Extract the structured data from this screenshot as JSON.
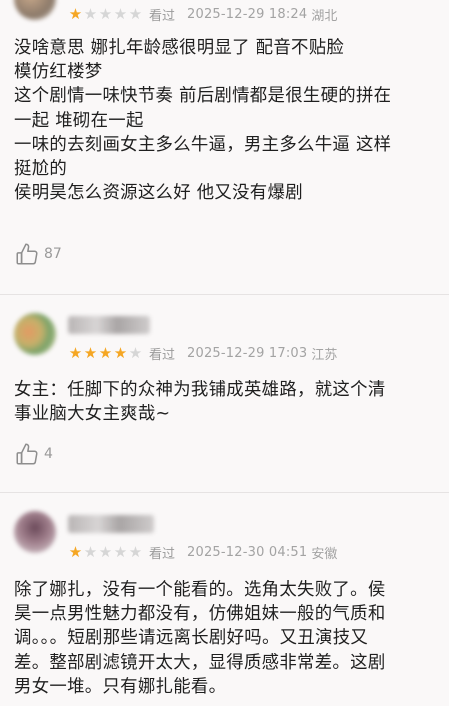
{
  "reviews": [
    {
      "stars": [
        true,
        false,
        false,
        false,
        false
      ],
      "status": "看过",
      "time": "2025-12-29 18:24",
      "location": "湖北",
      "text": "没啥意思 娜扎年龄感很明显了 配音不贴脸\n模仿红楼梦\n这个剧情一味快节奏 前后剧情都是很生硬的拼在\n一起 堆砌在一起\n一味的去刻画女主多么牛逼，男主多么牛逼 这样\n挺尬的\n侯明昊怎么资源这么好 他又没有爆剧",
      "likes": "87"
    },
    {
      "stars": [
        true,
        true,
        true,
        true,
        false
      ],
      "status": "看过",
      "time": "2025-12-29 17:03",
      "location": "江苏",
      "text": "女主：任脚下的众神为我铺成英雄路，就这个清\n事业脑大女主爽哉~",
      "likes": "4"
    },
    {
      "stars": [
        true,
        false,
        false,
        false,
        false
      ],
      "status": "看过",
      "time": "2025-12-30 04:51",
      "location": "安徽",
      "text": "除了娜扎，没有一个能看的。选角太失败了。侯\n昊一点男性魅力都没有，仿佛姐妹一般的气质和\n调。。。短剧那些请远离长剧好吗。又丑演技又\n差。整部剧滤镜开太大，显得质感非常差。这剧\n男女一堆。只有娜扎能看。"
    }
  ],
  "icons": {
    "star": "star-icon",
    "like": "thumbs-up-icon"
  },
  "colors": {
    "star_on": "#f5a623",
    "star_off": "#d6d6d6"
  }
}
